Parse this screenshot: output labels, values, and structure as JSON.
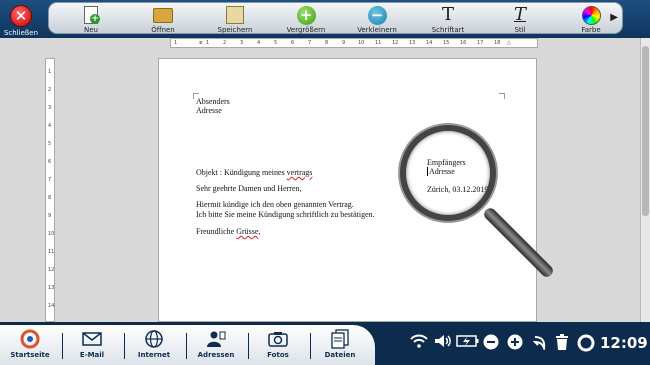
{
  "topbar": {
    "close_label": "Schließen",
    "tools": [
      {
        "label": "Neu",
        "icon": "new-document-icon"
      },
      {
        "label": "Öffnen",
        "icon": "open-folder-icon"
      },
      {
        "label": "Speichern",
        "icon": "save-icon"
      },
      {
        "label": "Vergrößern",
        "icon": "zoom-in-icon"
      },
      {
        "label": "Verkleinern",
        "icon": "zoom-out-icon"
      },
      {
        "label": "Schriftart",
        "icon": "font-icon"
      },
      {
        "label": "Stil",
        "icon": "style-icon"
      },
      {
        "label": "Farbe",
        "icon": "color-palette-icon"
      }
    ],
    "next_arrow": "▶"
  },
  "ruler": {
    "h_ticks": [
      "1",
      "1",
      "2",
      "3",
      "4",
      "5",
      "6",
      "7",
      "8",
      "9",
      "10",
      "11",
      "12",
      "13",
      "14",
      "15",
      "16",
      "17",
      "18"
    ],
    "v_ticks": [
      "1",
      "2",
      "3",
      "4",
      "5",
      "6",
      "7",
      "8",
      "9",
      "10",
      "11",
      "12",
      "13",
      "14"
    ]
  },
  "document": {
    "sender": "Absenders",
    "sender_address": "Adresse",
    "subject": "Objekt : Kündigung meines ",
    "subject_word": "vertrags",
    "salutation": "Sehr geehrte Damen und Herren,",
    "body_line1": "Hiermit kündige ich den oben genannten Vertrag.",
    "body_line2": "Ich bitte Sie meine Kündigung schriftlich zu bestätigen.",
    "closing_word": "Freundliche ",
    "closing_marked": "Grüsse",
    "closing_end": ","
  },
  "magnifier": {
    "recipient": "Empfängers",
    "recipient_address": "Adresse",
    "date_line": "Zürich, 03.12.2019"
  },
  "taskbar": {
    "items": [
      {
        "label": "Startseite",
        "icon": "home-logo-icon"
      },
      {
        "label": "E-Mail",
        "icon": "email-icon"
      },
      {
        "label": "Internet",
        "icon": "globe-icon"
      },
      {
        "label": "Adressen",
        "icon": "contacts-icon"
      },
      {
        "label": "Fotos",
        "icon": "camera-icon"
      },
      {
        "label": "Dateien",
        "icon": "files-icon"
      }
    ],
    "clock": "12:09"
  }
}
